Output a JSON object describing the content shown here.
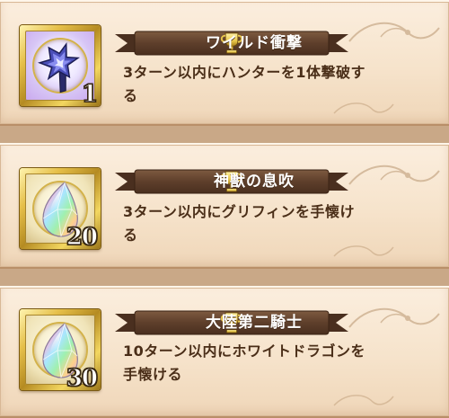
{
  "colors": {
    "panel_background": "#f6e3cb",
    "gap_background": "#c9a887",
    "banner_fill": "#6b4a34",
    "banner_text": "#ffffff",
    "description_text": "#4a2e18",
    "trophy_gold": "#e8c64a",
    "frame_gold": "#d9b13a"
  },
  "quests": [
    {
      "title": "ワイルド衝撃",
      "title_icon": "trophy-icon",
      "description": "3ターン以内にハンターを1体撃破する",
      "reward_icon": "crystal-flower-icon",
      "reward_count": "1"
    },
    {
      "title": "神獣の息吹",
      "title_icon": "trophy-icon",
      "description": "3ターン以内にグリフィンを手懐ける",
      "reward_icon": "rainbow-gem-icon",
      "reward_count": "20"
    },
    {
      "title": "大陸第二騎士",
      "title_icon": "trophy-icon",
      "description": "10ターン以内にホワイトドラゴンを手懐ける",
      "reward_icon": "rainbow-gem-icon",
      "reward_count": "30"
    }
  ]
}
